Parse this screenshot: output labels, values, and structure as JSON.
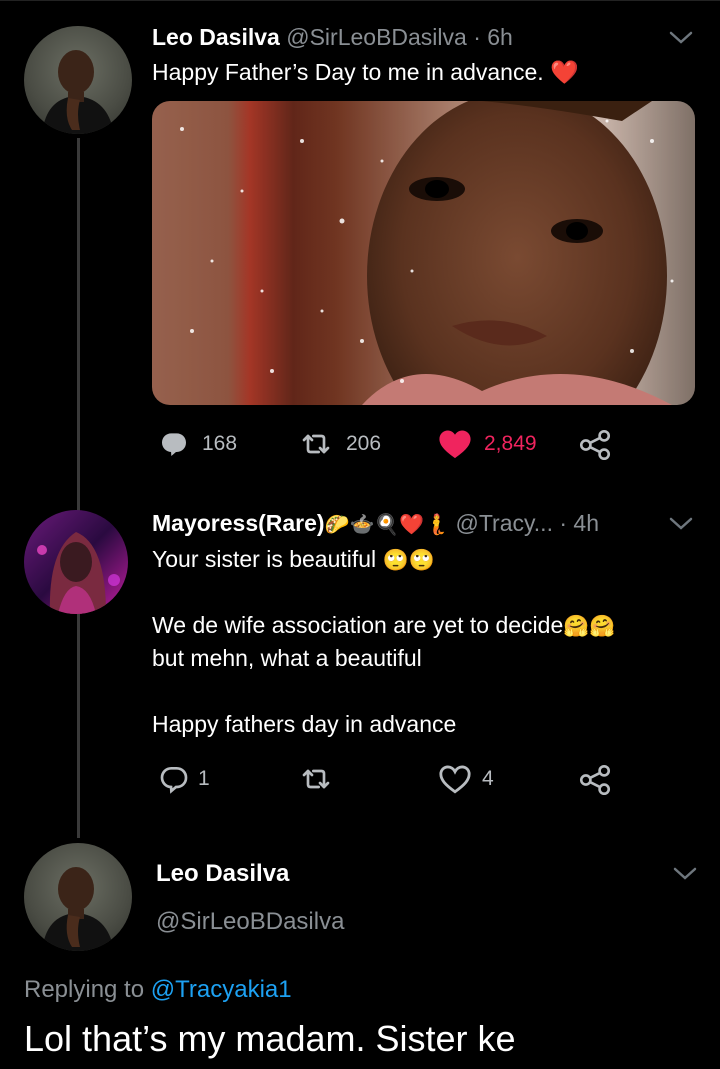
{
  "tweet1": {
    "name": "Leo Dasilva",
    "handle_time": "@SirLeoBDasilva · 6h",
    "text": "Happy Father’s Day to me in advance.",
    "heart_emoji": "❤️",
    "replies": "168",
    "retweets": "206",
    "likes": "2,849"
  },
  "tweet2": {
    "name": "Mayoress(Rare)",
    "emojis": "🌮🍲🍳❤️🧜",
    "handle_time": "@Tracy... · 4h",
    "line1": "Your sister is beautiful",
    "line1_emojis": "🙄🙄",
    "line2": "We de wife association are yet to decide",
    "line2_emojis": "🤗🤗",
    "line3": "but mehn, what a beautiful",
    "line4": "Happy fathers day in advance",
    "replies": "1",
    "retweets": "",
    "likes": "4"
  },
  "tweet3": {
    "name": "Leo Dasilva",
    "handle": "@SirLeoBDasilva",
    "replying_prefix": "Replying to",
    "replying_handle": "@Tracyakia1",
    "text": "Lol that’s my madam. Sister ke"
  },
  "colors": {
    "like": "#f0245e",
    "link": "#1da1f2",
    "muted": "#8a8f94"
  }
}
